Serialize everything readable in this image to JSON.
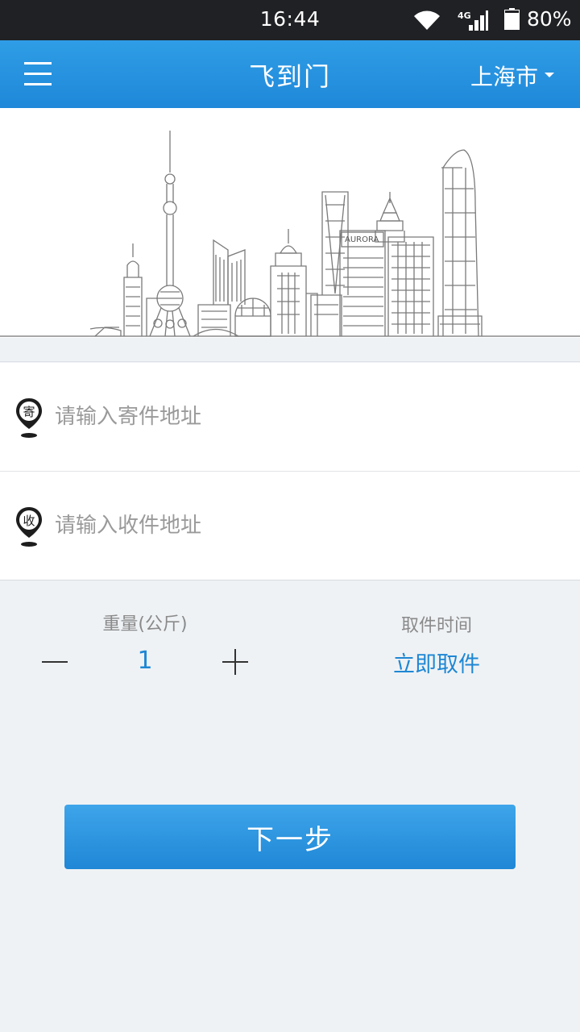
{
  "status_bar": {
    "time": "16:44",
    "network": "4G",
    "battery": "80%"
  },
  "header": {
    "title": "飞到门",
    "city": "上海市",
    "accent": "#2a95e0"
  },
  "banner": {
    "building_sign": "AURORA"
  },
  "sender": {
    "icon_label": "寄",
    "placeholder": "请输入寄件地址"
  },
  "receiver": {
    "icon_label": "收",
    "placeholder": "请输入收件地址"
  },
  "weight": {
    "label": "重量(公斤)",
    "value": "1"
  },
  "pickup": {
    "label": "取件时间",
    "value": "立即取件"
  },
  "next_button": {
    "label": "下一步"
  }
}
